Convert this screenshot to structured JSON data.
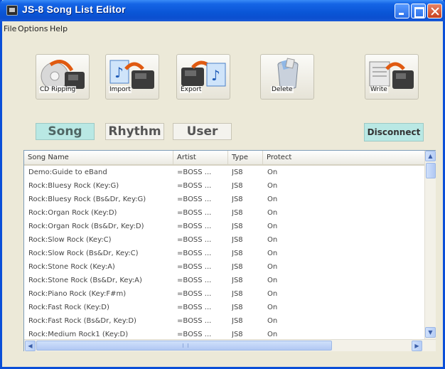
{
  "window": {
    "title": "JS-8 Song List Editor"
  },
  "menu": [
    "File",
    "Options",
    "Help"
  ],
  "toolbar": [
    {
      "label": "CD Ripping",
      "icon": "cd-ripping-icon"
    },
    {
      "label": "Import",
      "icon": "import-icon"
    },
    {
      "label": "Export",
      "icon": "export-icon"
    },
    {
      "label": "Delete",
      "icon": "trash-icon"
    },
    {
      "label": "Write",
      "icon": "write-icon"
    }
  ],
  "tabs": [
    {
      "label": "Song",
      "active": true
    },
    {
      "label": "Rhythm",
      "active": false
    },
    {
      "label": "User",
      "active": false
    }
  ],
  "disconnect_label": "Disconnect",
  "list": {
    "columns": [
      "Song Name",
      "Artist",
      "Type",
      "Protect"
    ],
    "rows": [
      [
        "Demo:Guide to eBand",
        "=BOSS ...",
        "JS8",
        "On"
      ],
      [
        "Rock:Bluesy Rock (Key:G)",
        "=BOSS ...",
        "JS8",
        "On"
      ],
      [
        "Rock:Bluesy Rock (Bs&Dr, Key:G)",
        "=BOSS ...",
        "JS8",
        "On"
      ],
      [
        "Rock:Organ Rock (Key:D)",
        "=BOSS ...",
        "JS8",
        "On"
      ],
      [
        "Rock:Organ Rock (Bs&Dr, Key:D)",
        "=BOSS ...",
        "JS8",
        "On"
      ],
      [
        "Rock:Slow Rock (Key:C)",
        "=BOSS ...",
        "JS8",
        "On"
      ],
      [
        "Rock:Slow Rock (Bs&Dr, Key:C)",
        "=BOSS ...",
        "JS8",
        "On"
      ],
      [
        "Rock:Stone Rock (Key:A)",
        "=BOSS ...",
        "JS8",
        "On"
      ],
      [
        "Rock:Stone Rock (Bs&Dr, Key:A)",
        "=BOSS ...",
        "JS8",
        "On"
      ],
      [
        "Rock:Piano Rock (Key:F#m)",
        "=BOSS ...",
        "JS8",
        "On"
      ],
      [
        "Rock:Fast Rock (Key:D)",
        "=BOSS ...",
        "JS8",
        "On"
      ],
      [
        "Rock:Fast Rock (Bs&Dr, Key:D)",
        "=BOSS ...",
        "JS8",
        "On"
      ],
      [
        "Rock:Medium Rock1 (Key:D)",
        "=BOSS ...",
        "JS8",
        "On"
      ]
    ]
  },
  "colors": {
    "title_bar": "#0a55d6",
    "tab_active": "#b9e8e4",
    "window_bg": "#ece9d8"
  }
}
